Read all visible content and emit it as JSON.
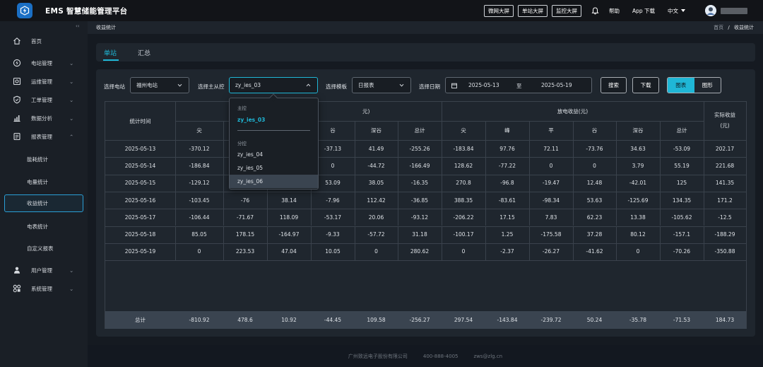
{
  "app": {
    "title": "EMS 智慧储能管理平台"
  },
  "topbar": {
    "screens": [
      "微网大屏",
      "单站大屏",
      "监控大屏"
    ],
    "help": "帮助",
    "app_download": "App 下载",
    "language": "中文"
  },
  "sidebar": {
    "items": [
      {
        "label": "首页",
        "icon": "home-icon"
      },
      {
        "label": "电站管理",
        "icon": "power-station-icon"
      },
      {
        "label": "运维管理",
        "icon": "maintenance-icon"
      },
      {
        "label": "工单管理",
        "icon": "work-order-icon"
      },
      {
        "label": "数据分析",
        "icon": "analytics-icon"
      },
      {
        "label": "报表管理",
        "icon": "report-icon"
      },
      {
        "label": "用户管理",
        "icon": "user-icon"
      },
      {
        "label": "系统管理",
        "icon": "system-icon"
      }
    ],
    "report_sub": [
      "能耗统计",
      "电量统计",
      "收益统计",
      "电表统计",
      "自定义报表"
    ]
  },
  "breadcrumb": {
    "page": "收益统计",
    "home": "首页",
    "separator": "/",
    "current": "收益统计"
  },
  "tabs": [
    "单站",
    "汇总"
  ],
  "filters": {
    "station_label": "选择电站",
    "station_value": "福州电站",
    "control_label": "选择主从控",
    "control_value": "zy_ies_03",
    "template_label": "选择模板",
    "template_value": "日报表",
    "date_label": "选择日期",
    "date_start": "2025-05-13",
    "date_to": "至",
    "date_end": "2025-05-19",
    "search_btn": "搜索",
    "download_btn": "下载",
    "view_table": "图表",
    "view_chart": "图形"
  },
  "dropdown": {
    "master_group": "主控",
    "master_options": [
      "zy_ies_03"
    ],
    "slave_group": "分控",
    "slave_options": [
      "zy_ies_04",
      "zy_ies_05",
      "zy_ies_06"
    ]
  },
  "table": {
    "time_header": "统计时间",
    "charge_group_suffix": "元)",
    "discharge_group": "放电收益(元)",
    "actual_header_1": "实际收益",
    "actual_header_2": "(元)",
    "charge_sub": [
      "尖",
      "",
      "",
      "谷",
      "深谷",
      "总计"
    ],
    "discharge_sub": [
      "尖",
      "峰",
      "平",
      "谷",
      "深谷",
      "总计"
    ],
    "rows": [
      [
        "2025-05-13",
        "-370.12",
        "",
        "",
        "-37.13",
        "41.49",
        "-255.26",
        "-183.84",
        "97.76",
        "72.11",
        "-73.76",
        "34.63",
        "-53.09",
        "202.17"
      ],
      [
        "2025-05-14",
        "-186.84",
        "",
        "",
        "0",
        "-44.72",
        "-166.49",
        "128.62",
        "-77.22",
        "0",
        "0",
        "3.79",
        "55.19",
        "221.68"
      ],
      [
        "2025-05-15",
        "-129.12",
        "",
        "",
        "53.09",
        "38.05",
        "-16.35",
        "270.8",
        "-96.8",
        "-19.47",
        "12.48",
        "-42.01",
        "125",
        "141.35"
      ],
      [
        "2025-05-16",
        "-103.45",
        "-76",
        "38.14",
        "-7.96",
        "112.42",
        "-36.85",
        "388.35",
        "-83.61",
        "-98.34",
        "53.63",
        "-125.69",
        "134.35",
        "171.2"
      ],
      [
        "2025-05-17",
        "-106.44",
        "-71.67",
        "118.09",
        "-53.17",
        "20.06",
        "-93.12",
        "-206.22",
        "17.15",
        "7.83",
        "62.23",
        "13.38",
        "-105.62",
        "-12.5"
      ],
      [
        "2025-05-18",
        "85.05",
        "178.15",
        "-164.97",
        "-9.33",
        "-57.72",
        "31.18",
        "-100.17",
        "1.25",
        "-175.58",
        "37.28",
        "80.12",
        "-157.1",
        "-188.29"
      ],
      [
        "2025-05-19",
        "0",
        "223.53",
        "47.04",
        "10.05",
        "0",
        "280.62",
        "0",
        "-2.37",
        "-26.27",
        "-41.62",
        "0",
        "-70.26",
        "-350.88"
      ]
    ],
    "total": [
      "总计",
      "-810.92",
      "478.6",
      "10.92",
      "-44.45",
      "109.58",
      "-256.27",
      "297.54",
      "-143.84",
      "-239.72",
      "50.24",
      "-35.78",
      "-71.53",
      "184.73"
    ]
  },
  "footer": {
    "company": "广州致远电子股份有限公司",
    "phone": "400-888-4005",
    "email": "zws@zlg.cn"
  },
  "colors": {
    "accent": "#1fb7d6",
    "background": "#151a21",
    "panel": "#1f262e"
  }
}
